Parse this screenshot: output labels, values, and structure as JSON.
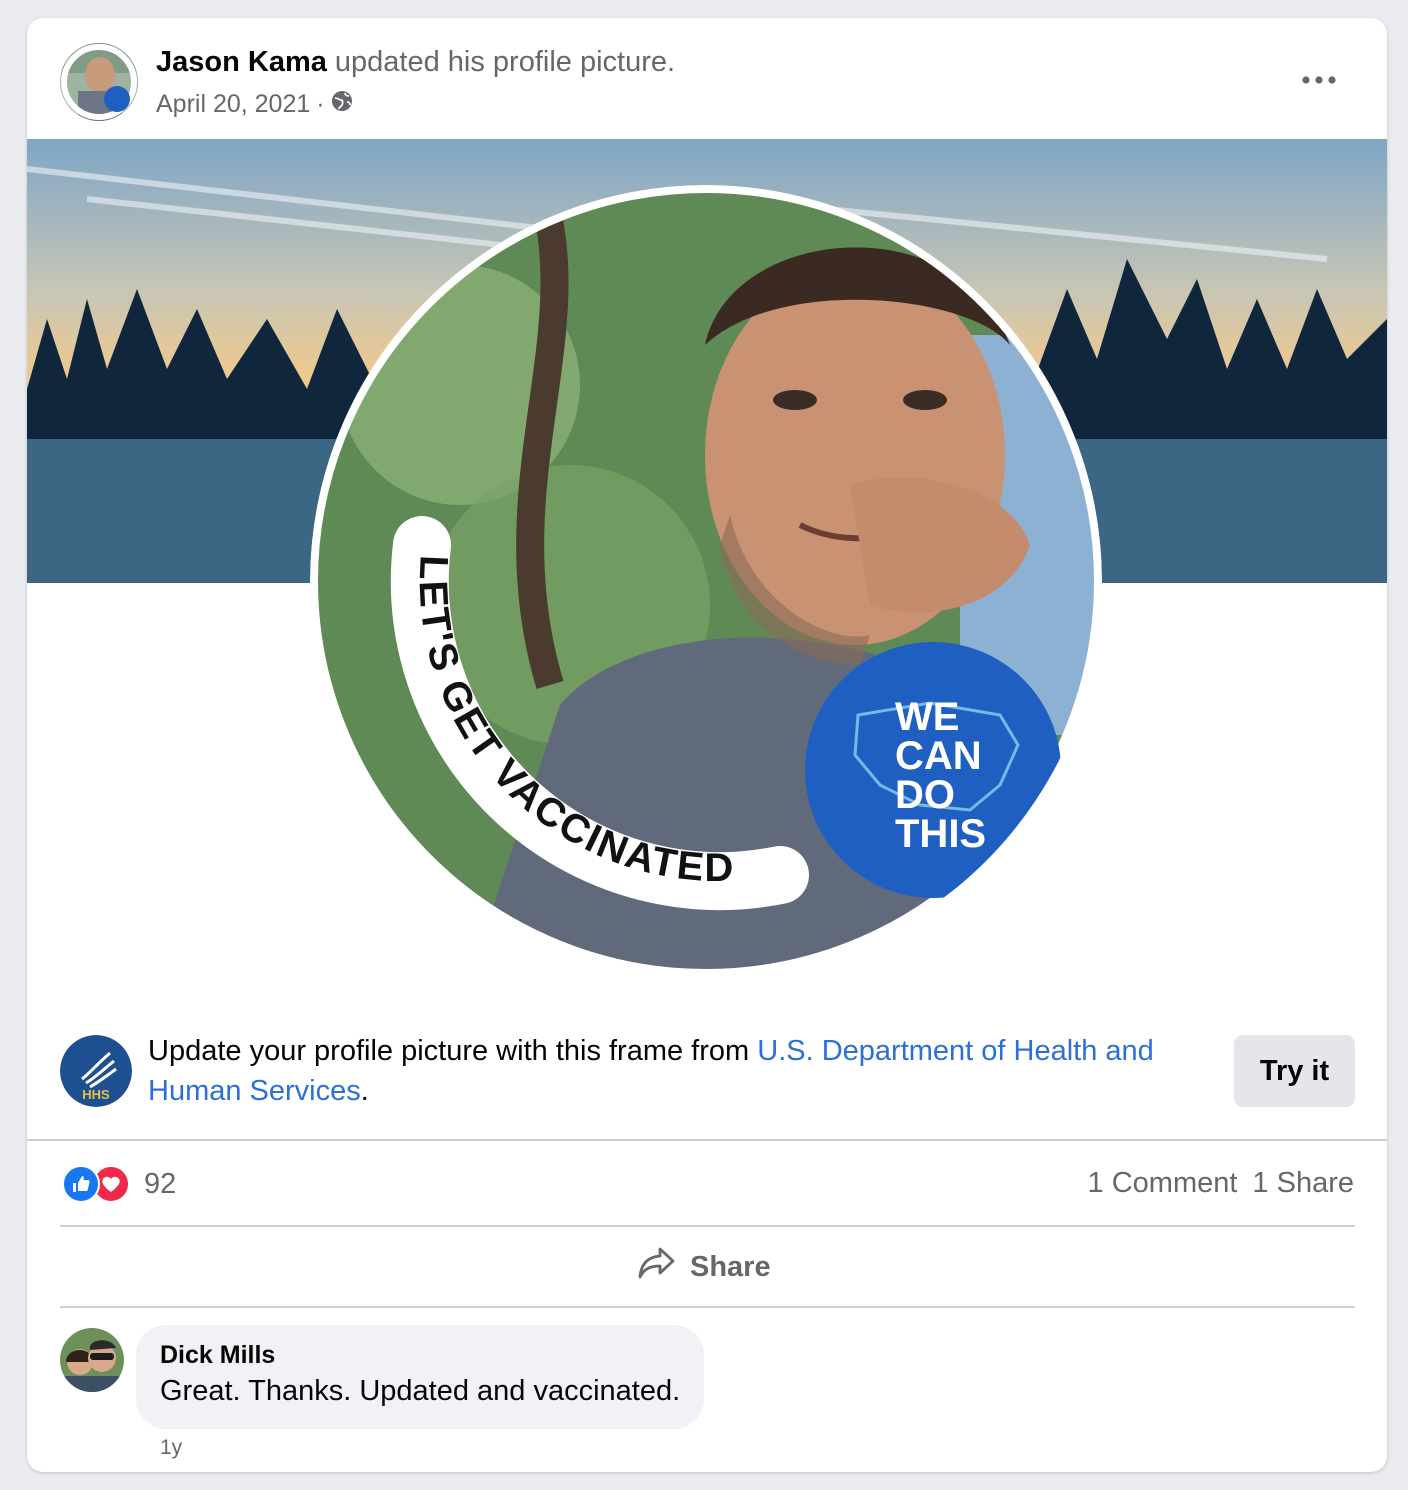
{
  "post": {
    "author": "Jason Kama",
    "action": " updated his profile picture.",
    "date": "April 20, 2021",
    "separator": "·",
    "privacy_icon": "globe-icon",
    "more_icon": "more-options-icon"
  },
  "photo": {
    "frame_ring_text": "LET'S GET VACCINATED",
    "badge_lines": [
      "WE",
      "CAN",
      "DO",
      "THIS"
    ]
  },
  "frame_prompt": {
    "logo_text": "HHS",
    "text_before": "Update your profile picture with this frame from ",
    "link_text": "U.S. Department of Health and Human Services",
    "text_after": ".",
    "button_label": "Try it"
  },
  "stats": {
    "reaction_icons": [
      "like-icon",
      "love-icon"
    ],
    "reaction_count": "92",
    "comments": "1 Comment",
    "shares": "1 Share"
  },
  "actions": {
    "share_label": "Share",
    "share_icon": "share-arrow-icon"
  },
  "comment": {
    "author": "Dick Mills",
    "text": "Great. Thanks. Updated and vaccinated.",
    "time": "1y"
  },
  "colors": {
    "link": "#2d6fd8",
    "like": "#1877f2",
    "love": "#f02849",
    "badge_blue": "#1f5fc2",
    "secondary_text": "#65676b"
  }
}
